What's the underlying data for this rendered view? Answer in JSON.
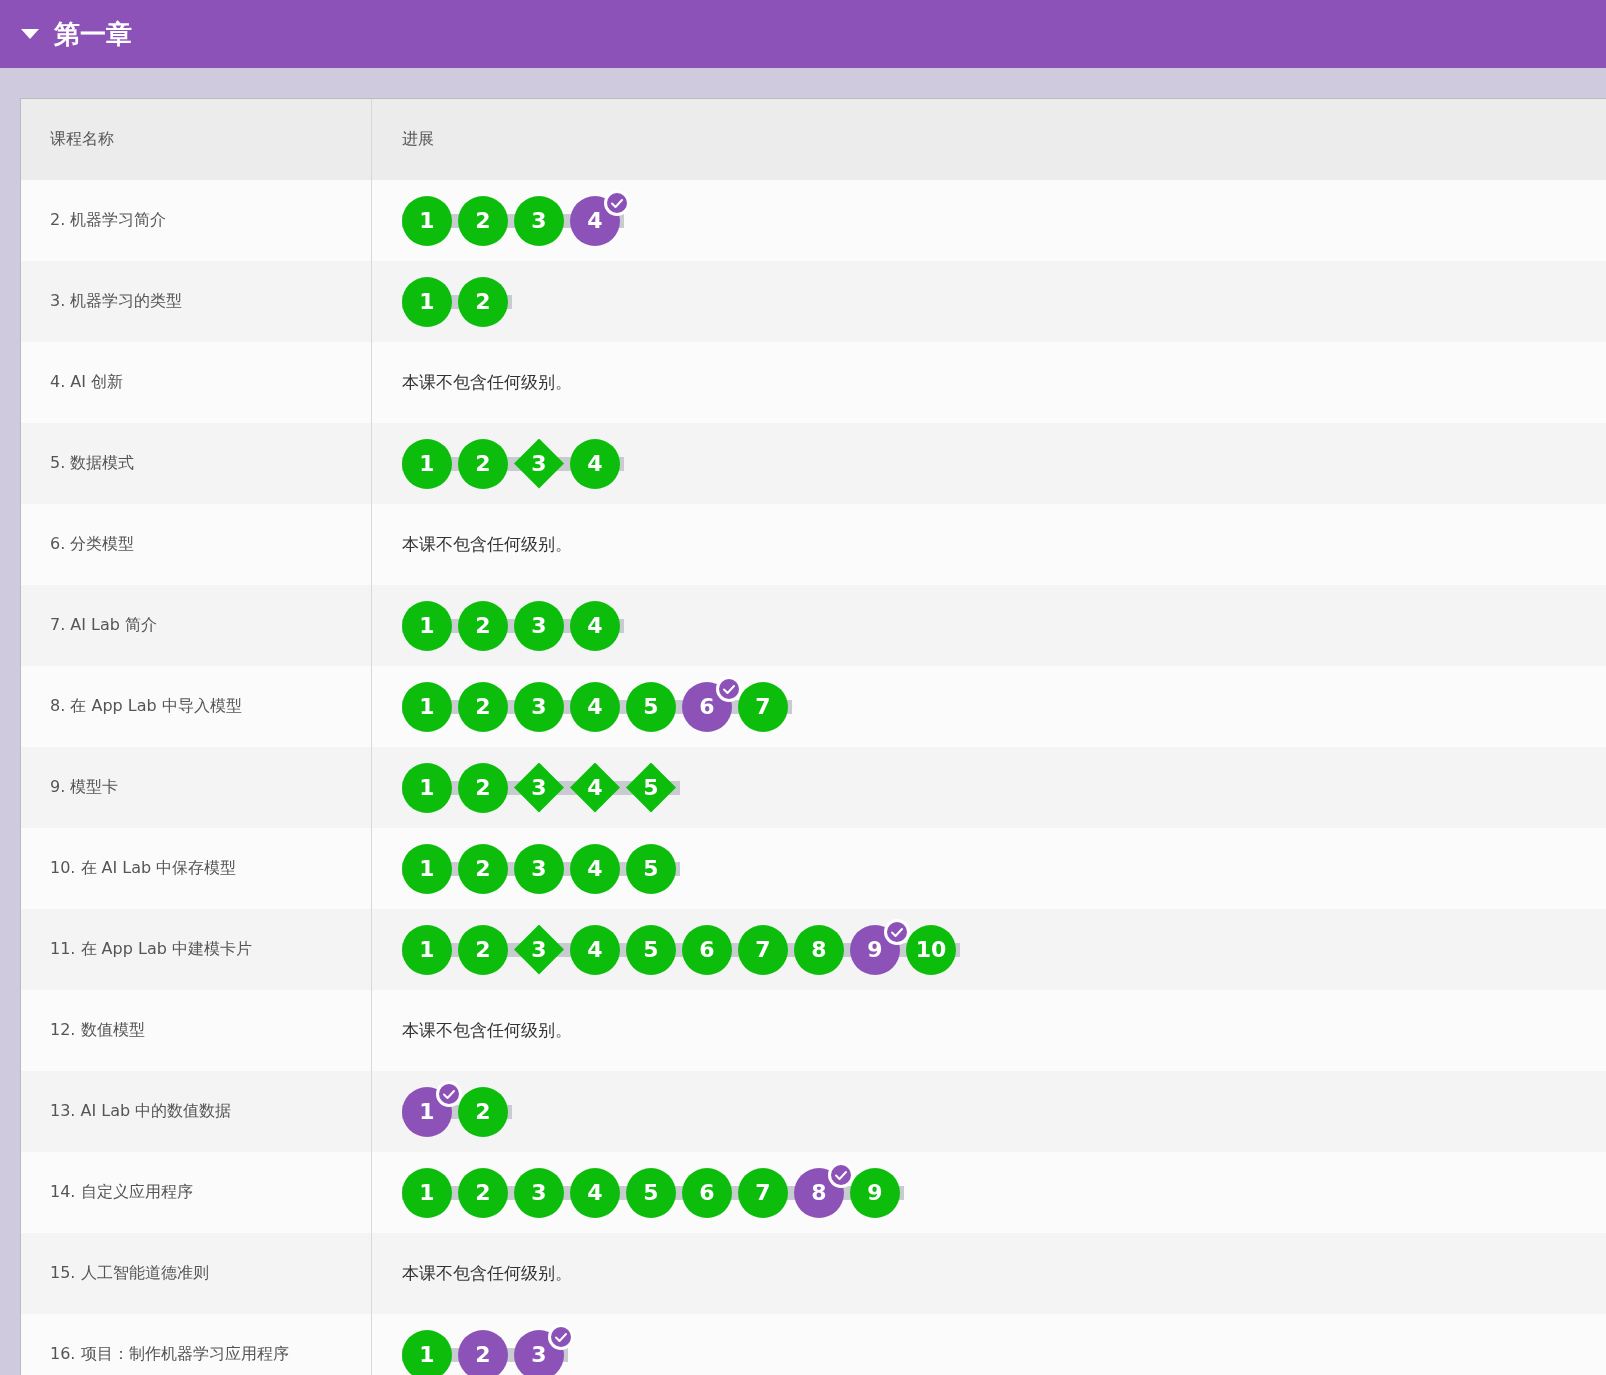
{
  "section": {
    "title": "第一章",
    "expanded": true
  },
  "table": {
    "columns": [
      "课程名称",
      "进展"
    ],
    "rows": [
      {
        "name": "2. 机器学习简介",
        "levels": [
          {
            "label": "1",
            "kind": "circle",
            "color": "#0cbd0c",
            "checked": false
          },
          {
            "label": "2",
            "kind": "circle",
            "color": "#0cbd0c",
            "checked": false
          },
          {
            "label": "3",
            "kind": "circle",
            "color": "#0cbd0c",
            "checked": false
          },
          {
            "label": "4",
            "kind": "circle",
            "color": "#8c52b8",
            "checked": true
          }
        ]
      },
      {
        "name": "3. 机器学习的类型",
        "levels": [
          {
            "label": "1",
            "kind": "circle",
            "color": "#0cbd0c",
            "checked": false
          },
          {
            "label": "2",
            "kind": "circle",
            "color": "#0cbd0c",
            "checked": false
          }
        ]
      },
      {
        "name": "4. AI 创新",
        "message": "本课不包含任何级别。"
      },
      {
        "name": "5. 数据模式",
        "levels": [
          {
            "label": "1",
            "kind": "circle",
            "color": "#0cbd0c",
            "checked": false
          },
          {
            "label": "2",
            "kind": "circle",
            "color": "#0cbd0c",
            "checked": false
          },
          {
            "label": "3",
            "kind": "diamond",
            "color": "#0cbd0c",
            "checked": false
          },
          {
            "label": "4",
            "kind": "circle",
            "color": "#0cbd0c",
            "checked": false
          }
        ]
      },
      {
        "name": "6. 分类模型",
        "message": "本课不包含任何级别。"
      },
      {
        "name": "7. AI Lab 简介",
        "levels": [
          {
            "label": "1",
            "kind": "circle",
            "color": "#0cbd0c",
            "checked": false
          },
          {
            "label": "2",
            "kind": "circle",
            "color": "#0cbd0c",
            "checked": false
          },
          {
            "label": "3",
            "kind": "circle",
            "color": "#0cbd0c",
            "checked": false
          },
          {
            "label": "4",
            "kind": "circle",
            "color": "#0cbd0c",
            "checked": false
          }
        ]
      },
      {
        "name": "8. 在 App Lab 中导入模型",
        "levels": [
          {
            "label": "1",
            "kind": "circle",
            "color": "#0cbd0c",
            "checked": false
          },
          {
            "label": "2",
            "kind": "circle",
            "color": "#0cbd0c",
            "checked": false
          },
          {
            "label": "3",
            "kind": "circle",
            "color": "#0cbd0c",
            "checked": false
          },
          {
            "label": "4",
            "kind": "circle",
            "color": "#0cbd0c",
            "checked": false
          },
          {
            "label": "5",
            "kind": "circle",
            "color": "#0cbd0c",
            "checked": false
          },
          {
            "label": "6",
            "kind": "circle",
            "color": "#8c52b8",
            "checked": true
          },
          {
            "label": "7",
            "kind": "circle",
            "color": "#0cbd0c",
            "checked": false
          }
        ]
      },
      {
        "name": "9. 模型卡",
        "levels": [
          {
            "label": "1",
            "kind": "circle",
            "color": "#0cbd0c",
            "checked": false
          },
          {
            "label": "2",
            "kind": "circle",
            "color": "#0cbd0c",
            "checked": false
          },
          {
            "label": "3",
            "kind": "diamond",
            "color": "#0cbd0c",
            "checked": false
          },
          {
            "label": "4",
            "kind": "diamond",
            "color": "#0cbd0c",
            "checked": false
          },
          {
            "label": "5",
            "kind": "diamond",
            "color": "#0cbd0c",
            "checked": false
          }
        ]
      },
      {
        "name": "10. 在 AI Lab 中保存模型",
        "levels": [
          {
            "label": "1",
            "kind": "circle",
            "color": "#0cbd0c",
            "checked": false
          },
          {
            "label": "2",
            "kind": "circle",
            "color": "#0cbd0c",
            "checked": false
          },
          {
            "label": "3",
            "kind": "circle",
            "color": "#0cbd0c",
            "checked": false
          },
          {
            "label": "4",
            "kind": "circle",
            "color": "#0cbd0c",
            "checked": false
          },
          {
            "label": "5",
            "kind": "circle",
            "color": "#0cbd0c",
            "checked": false
          }
        ]
      },
      {
        "name": "11. 在 App Lab 中建模卡片",
        "levels": [
          {
            "label": "1",
            "kind": "circle",
            "color": "#0cbd0c",
            "checked": false
          },
          {
            "label": "2",
            "kind": "circle",
            "color": "#0cbd0c",
            "checked": false
          },
          {
            "label": "3",
            "kind": "diamond",
            "color": "#0cbd0c",
            "checked": false
          },
          {
            "label": "4",
            "kind": "circle",
            "color": "#0cbd0c",
            "checked": false
          },
          {
            "label": "5",
            "kind": "circle",
            "color": "#0cbd0c",
            "checked": false
          },
          {
            "label": "6",
            "kind": "circle",
            "color": "#0cbd0c",
            "checked": false
          },
          {
            "label": "7",
            "kind": "circle",
            "color": "#0cbd0c",
            "checked": false
          },
          {
            "label": "8",
            "kind": "circle",
            "color": "#0cbd0c",
            "checked": false
          },
          {
            "label": "9",
            "kind": "circle",
            "color": "#8c52b8",
            "checked": true
          },
          {
            "label": "10",
            "kind": "circle",
            "color": "#0cbd0c",
            "checked": false
          }
        ]
      },
      {
        "name": "12. 数值模型",
        "message": "本课不包含任何级别。"
      },
      {
        "name": "13. AI Lab 中的数值数据",
        "levels": [
          {
            "label": "1",
            "kind": "circle",
            "color": "#8c52b8",
            "checked": true
          },
          {
            "label": "2",
            "kind": "circle",
            "color": "#0cbd0c",
            "checked": false
          }
        ]
      },
      {
        "name": "14. 自定义应用程序",
        "levels": [
          {
            "label": "1",
            "kind": "circle",
            "color": "#0cbd0c",
            "checked": false
          },
          {
            "label": "2",
            "kind": "circle",
            "color": "#0cbd0c",
            "checked": false
          },
          {
            "label": "3",
            "kind": "circle",
            "color": "#0cbd0c",
            "checked": false
          },
          {
            "label": "4",
            "kind": "circle",
            "color": "#0cbd0c",
            "checked": false
          },
          {
            "label": "5",
            "kind": "circle",
            "color": "#0cbd0c",
            "checked": false
          },
          {
            "label": "6",
            "kind": "circle",
            "color": "#0cbd0c",
            "checked": false
          },
          {
            "label": "7",
            "kind": "circle",
            "color": "#0cbd0c",
            "checked": false
          },
          {
            "label": "8",
            "kind": "circle",
            "color": "#8c52b8",
            "checked": true
          },
          {
            "label": "9",
            "kind": "circle",
            "color": "#0cbd0c",
            "checked": false
          }
        ]
      },
      {
        "name": "15. 人工智能道德准则",
        "message": "本课不包含任何级别。"
      },
      {
        "name": "16. 项目：制作机器学习应用程序",
        "levels": [
          {
            "label": "1",
            "kind": "circle",
            "color": "#0cbd0c",
            "checked": false
          },
          {
            "label": "2",
            "kind": "circle",
            "color": "#8c52b8",
            "checked": false
          },
          {
            "label": "3",
            "kind": "circle",
            "color": "#8c52b8",
            "checked": true
          }
        ]
      }
    ]
  }
}
